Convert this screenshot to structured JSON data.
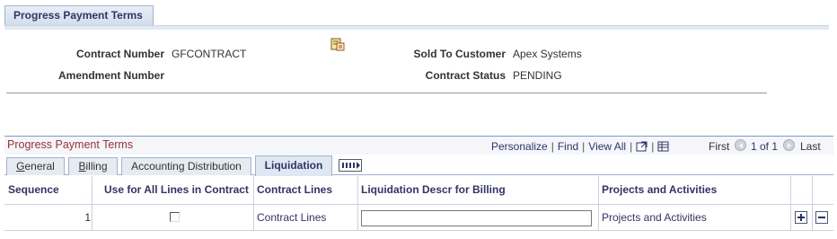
{
  "page_tab": {
    "label": "Progress Payment Terms"
  },
  "header": {
    "contract_number_label": "Contract Number",
    "contract_number_value": "GFCONTRACT",
    "amendment_number_label": "Amendment Number",
    "sold_to_customer_label": "Sold To Customer",
    "sold_to_customer_value": "Apex Systems",
    "contract_status_label": "Contract Status",
    "contract_status_value": "PENDING"
  },
  "grid": {
    "title": "Progress Payment Terms",
    "nav": {
      "personalize": "Personalize",
      "find": "Find",
      "view_all": "View All",
      "first": "First",
      "count": "1 of 1",
      "last": "Last"
    },
    "tabs": [
      {
        "label": "General"
      },
      {
        "label": "Billing"
      },
      {
        "label": "Accounting Distribution"
      },
      {
        "label": "Liquidation"
      }
    ],
    "columns": {
      "sequence": "Sequence",
      "use_all": "Use for All Lines in Contract",
      "contract_lines": "Contract Lines",
      "liquidation_descr": "Liquidation Descr for Billing",
      "projects": "Projects and Activities"
    },
    "rows": [
      {
        "sequence": "1",
        "use_all_checked": false,
        "contract_lines": "Contract Lines",
        "liquidation_descr": "",
        "projects": "Projects and Activities"
      }
    ]
  }
}
